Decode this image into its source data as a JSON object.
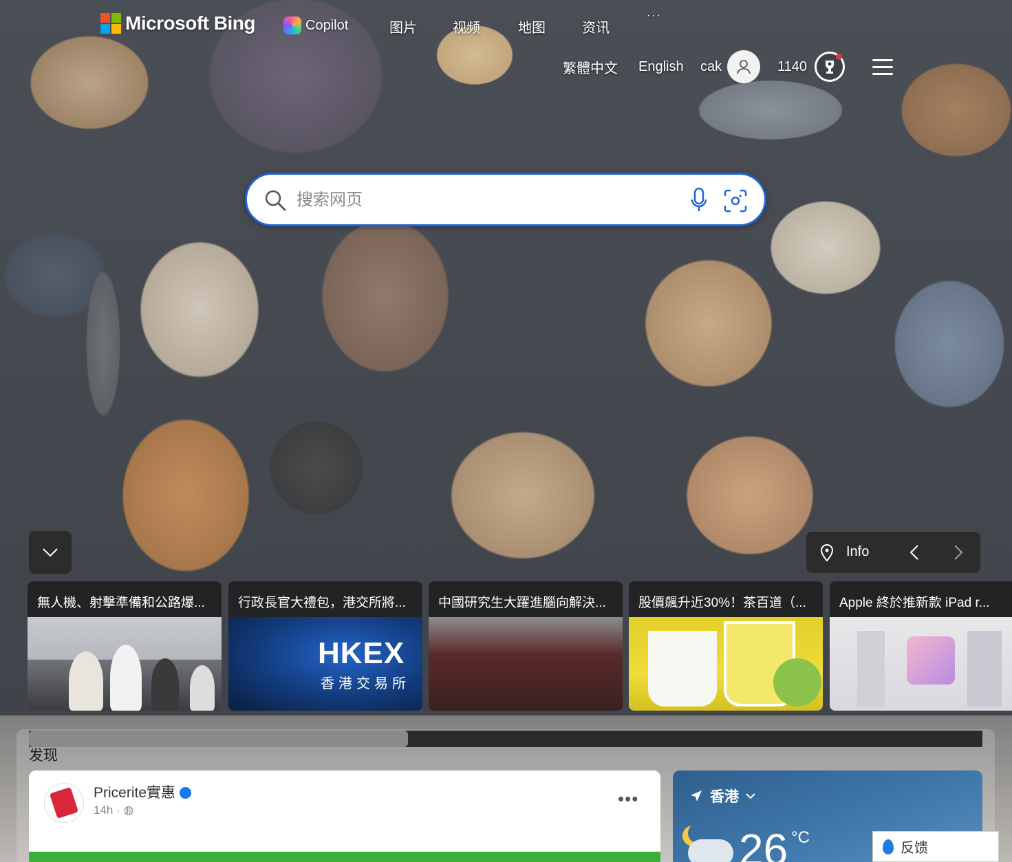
{
  "header": {
    "logo_text": "Microsoft Bing",
    "nav": [
      {
        "id": "copilot",
        "label": "Copilot",
        "icon": "copilot-icon"
      },
      {
        "id": "images",
        "label": "图片"
      },
      {
        "id": "videos",
        "label": "视频"
      },
      {
        "id": "maps",
        "label": "地图"
      },
      {
        "id": "news",
        "label": "资讯"
      }
    ],
    "more_icon": "more-icon"
  },
  "topright": {
    "lang_traditional": "繁體中文",
    "lang_english": "English",
    "username": "cak",
    "points": "1140",
    "avatar_icon": "user-avatar-icon",
    "rewards_icon": "rewards-trophy-icon",
    "menu_icon": "hamburger-menu-icon"
  },
  "search": {
    "placeholder": "搜索网页",
    "search_icon": "search-icon",
    "mic_icon": "microphone-icon",
    "visual_icon": "visual-search-icon",
    "border_color": "#1f66d6"
  },
  "carousel": {
    "info_label": "Info",
    "cards": [
      {
        "title": "無人機、射擊準備和公路爆..."
      },
      {
        "title": "行政長官大禮包，港交所將..."
      },
      {
        "title": "中國研究生大躍進腦向解決..."
      },
      {
        "title": "股價飆升近30%！茶百道（..."
      },
      {
        "title": "Apple 終於推新款 iPad r..."
      }
    ],
    "hkex_logo": "HKEX",
    "hkex_sub": "香港交易所"
  },
  "discover": {
    "heading": "发现",
    "post": {
      "name": "Pricerite實惠",
      "time": "14h · ",
      "more": "•••"
    },
    "weather": {
      "location": "香港",
      "temperature": "26",
      "unit": "°C"
    }
  },
  "feedback": {
    "label": "反馈"
  },
  "colors": {
    "accent": "#1f66d6",
    "ms_red": "#f25022",
    "ms_green": "#7fba00",
    "ms_blue": "#00a4ef",
    "ms_yellow": "#ffb900"
  }
}
